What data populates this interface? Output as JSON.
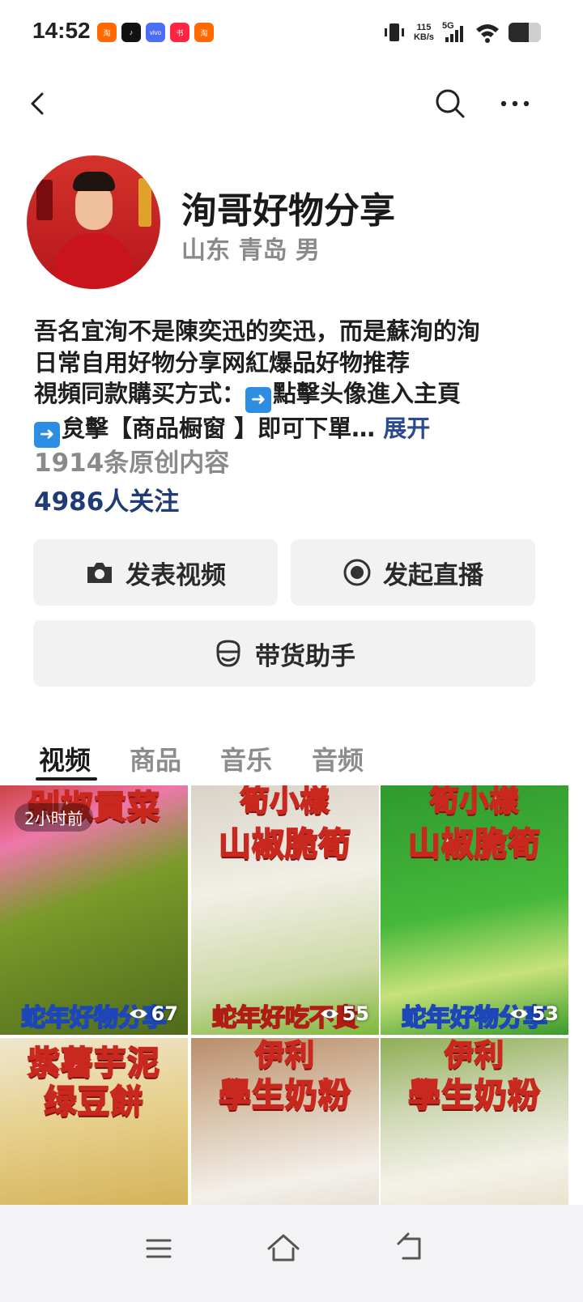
{
  "status_bar": {
    "time": "14:52",
    "app_icons": [
      {
        "name": "taobao-icon",
        "color": "#ff6a00",
        "label": "淘"
      },
      {
        "name": "tiktok-icon",
        "color": "#111111",
        "label": "♪"
      },
      {
        "name": "vivo-icon",
        "color": "#4a6cf7",
        "label": "vivo"
      },
      {
        "name": "xiaohongshu-icon",
        "color": "#ff2442",
        "label": "书"
      },
      {
        "name": "taobao-alt-icon",
        "color": "#ff6a00",
        "label": "淘"
      }
    ],
    "net_speed_value": "115",
    "net_speed_unit": "KB/s",
    "network": "5G"
  },
  "profile": {
    "name": "洵哥好物分享",
    "location": "山东 青岛 男",
    "bio_line1": "吾名宜洵不是陳奕迅的奕迅，而是蘇洵的洵",
    "bio_line2": "日常自用好物分享网紅爆品好物推荐",
    "bio_line3_prefix": "視頻同款購买方式：",
    "bio_line3_suffix": "點擊头像進入主頁",
    "bio_line4": "炱擊【商品橱窗 】即可下單…",
    "expand_label": "展开",
    "original_count": "1914条原创内容",
    "followers": "4986人关注"
  },
  "actions": {
    "publish_video": "发表视频",
    "start_live": "发起直播",
    "sales_assistant": "带货助手"
  },
  "tabs": [
    "视频",
    "商品",
    "音乐",
    "音频"
  ],
  "grid": [
    {
      "title": "剁椒貢菜",
      "bottom": "蛇年好物分享",
      "views": "67",
      "badge": "2小时前"
    },
    {
      "title": "山椒脆筍",
      "title_top": "筍小樣",
      "bottom": "蛇年好吃不貴",
      "views": "55"
    },
    {
      "title": "山椒脆筍",
      "title_top": "筍小樣",
      "bottom": "蛇年好物分享",
      "views": "53"
    },
    {
      "title": "紫薯芋泥",
      "title2": "绿豆餅"
    },
    {
      "title_top": "伊利",
      "title": "學生奶粉"
    },
    {
      "title_top": "伊利",
      "title": "學生奶粉"
    }
  ]
}
